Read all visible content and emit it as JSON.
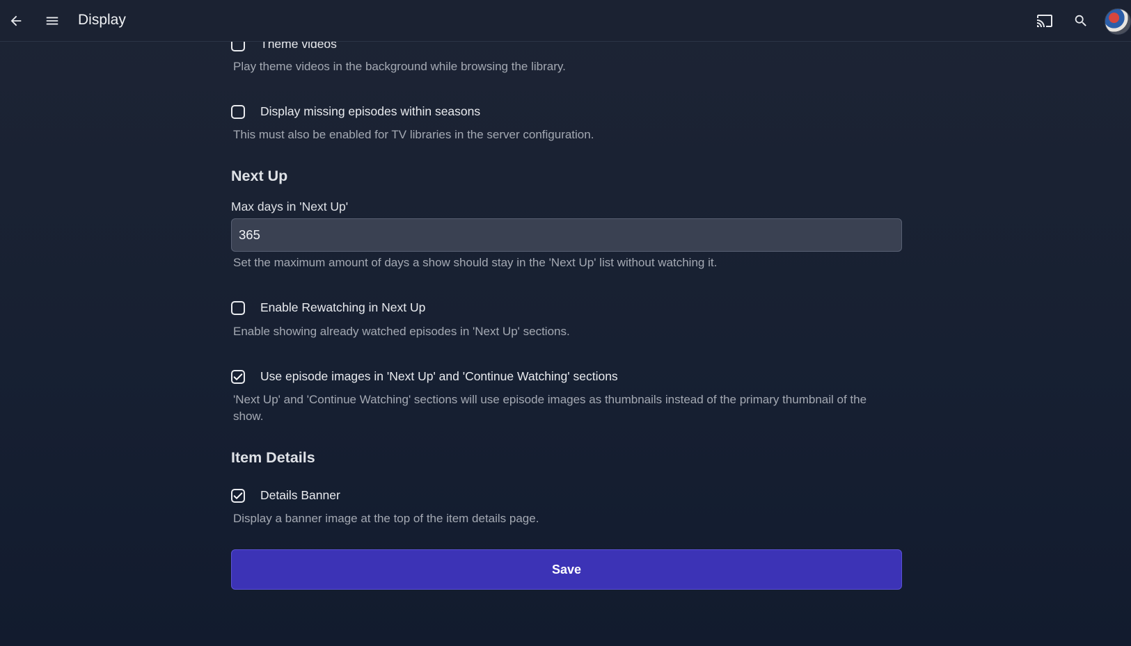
{
  "header": {
    "title": "Display",
    "back_icon": "arrow-left-icon",
    "menu_icon": "hamburger-menu-icon",
    "cast_icon": "cast-icon",
    "search_icon": "search-icon"
  },
  "settings": {
    "theme_videos": {
      "label": "Theme videos",
      "checked": false,
      "description": "Play theme videos in the background while browsing the library."
    },
    "missing_episodes": {
      "label": "Display missing episodes within seasons",
      "checked": false,
      "description": "This must also be enabled for TV libraries in the server configuration."
    },
    "next_up": {
      "heading": "Next Up",
      "max_days_label": "Max days in 'Next Up'",
      "max_days_value": "365",
      "max_days_description": "Set the maximum amount of days a show should stay in the 'Next Up' list without watching it.",
      "rewatching": {
        "label": "Enable Rewatching in Next Up",
        "checked": false,
        "description": "Enable showing already watched episodes in 'Next Up' sections."
      },
      "episode_images": {
        "label": "Use episode images in 'Next Up' and 'Continue Watching' sections",
        "checked": true,
        "description_line1": "'Next Up' and 'Continue Watching' sections will use episode images as thumbnails instead of the primary thumbnail of the",
        "description_line2": "show."
      }
    },
    "item_details": {
      "heading": "Item Details",
      "details_banner": {
        "label": "Details Banner",
        "checked": true,
        "description": "Display a banner image at the top of the item details page."
      }
    }
  },
  "actions": {
    "save_label": "Save"
  },
  "colors": {
    "background": "#172032",
    "header": "#1b2232",
    "accent": "#3c33b6",
    "input_bg": "#3a4152"
  }
}
